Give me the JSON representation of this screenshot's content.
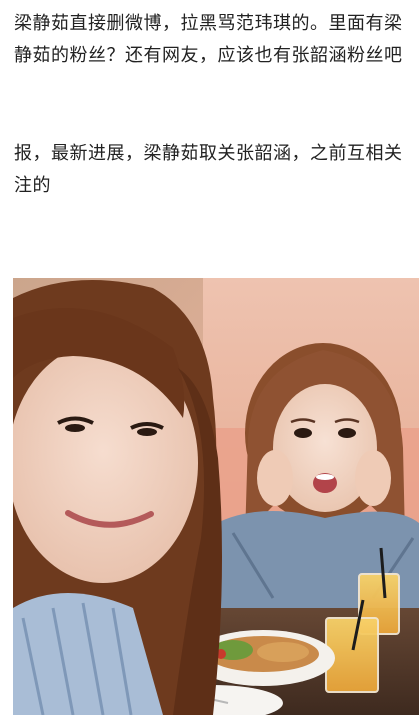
{
  "post": {
    "paragraphs": [
      "梁静茹直接删微博，拉黑骂范玮琪的。里面有梁静茹的粉丝？还有网友，应该也有张韶涵粉丝吧",
      "报，最新进展，梁静茹取关张韶涵，之前互相关注的"
    ]
  },
  "photo": {
    "subject": "selfie of two women at a restaurant table with food and orange juice"
  },
  "colors": {
    "text": "#222222",
    "background": "#ffffff"
  }
}
